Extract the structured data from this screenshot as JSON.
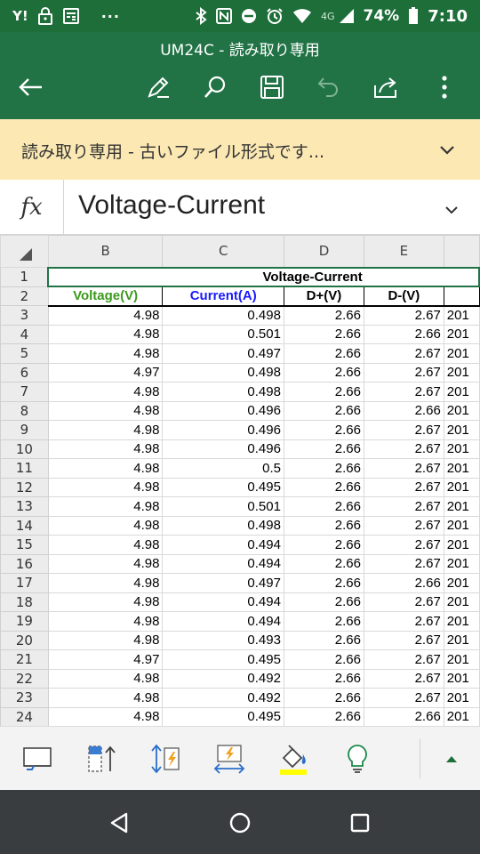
{
  "status_bar": {
    "carrier_icon": "Y!",
    "dots": "···",
    "network": "4G",
    "battery_pct": "74%",
    "time": "7:10"
  },
  "app_bar": {
    "title": "UM24C - 読み取り専用",
    "icons": [
      "back-arrow-icon",
      "edit-pen-icon",
      "search-icon",
      "save-disk-icon",
      "undo-icon",
      "share-icon",
      "more-vert-icon"
    ]
  },
  "banner": {
    "text": "読み取り専用 - 古いファイル形式です..."
  },
  "formula_bar": {
    "fx_label": "fx",
    "content": "Voltage-Current"
  },
  "sheet": {
    "column_headers": [
      "B",
      "C",
      "D",
      "E",
      ""
    ],
    "title_row": {
      "row": "1",
      "title": "Voltage-Current"
    },
    "header_row": {
      "row": "2",
      "cells": [
        "Voltage(V)",
        "Current(A)",
        "D+(V)",
        "D-(V)",
        ""
      ]
    },
    "rows": [
      {
        "row": "3",
        "v": "4.98",
        "c": "0.498",
        "dp": "2.66",
        "dm": "2.67",
        "f": "201"
      },
      {
        "row": "4",
        "v": "4.98",
        "c": "0.501",
        "dp": "2.66",
        "dm": "2.66",
        "f": "201"
      },
      {
        "row": "5",
        "v": "4.98",
        "c": "0.497",
        "dp": "2.66",
        "dm": "2.67",
        "f": "201"
      },
      {
        "row": "6",
        "v": "4.97",
        "c": "0.498",
        "dp": "2.66",
        "dm": "2.67",
        "f": "201"
      },
      {
        "row": "7",
        "v": "4.98",
        "c": "0.498",
        "dp": "2.66",
        "dm": "2.67",
        "f": "201"
      },
      {
        "row": "8",
        "v": "4.98",
        "c": "0.496",
        "dp": "2.66",
        "dm": "2.66",
        "f": "201"
      },
      {
        "row": "9",
        "v": "4.98",
        "c": "0.496",
        "dp": "2.66",
        "dm": "2.67",
        "f": "201"
      },
      {
        "row": "10",
        "v": "4.98",
        "c": "0.496",
        "dp": "2.66",
        "dm": "2.67",
        "f": "201"
      },
      {
        "row": "11",
        "v": "4.98",
        "c": "0.5",
        "dp": "2.66",
        "dm": "2.67",
        "f": "201"
      },
      {
        "row": "12",
        "v": "4.98",
        "c": "0.495",
        "dp": "2.66",
        "dm": "2.67",
        "f": "201"
      },
      {
        "row": "13",
        "v": "4.98",
        "c": "0.501",
        "dp": "2.66",
        "dm": "2.67",
        "f": "201"
      },
      {
        "row": "14",
        "v": "4.98",
        "c": "0.498",
        "dp": "2.66",
        "dm": "2.67",
        "f": "201"
      },
      {
        "row": "15",
        "v": "4.98",
        "c": "0.494",
        "dp": "2.66",
        "dm": "2.67",
        "f": "201"
      },
      {
        "row": "16",
        "v": "4.98",
        "c": "0.494",
        "dp": "2.66",
        "dm": "2.67",
        "f": "201"
      },
      {
        "row": "17",
        "v": "4.98",
        "c": "0.497",
        "dp": "2.66",
        "dm": "2.66",
        "f": "201"
      },
      {
        "row": "18",
        "v": "4.98",
        "c": "0.494",
        "dp": "2.66",
        "dm": "2.67",
        "f": "201"
      },
      {
        "row": "19",
        "v": "4.98",
        "c": "0.494",
        "dp": "2.66",
        "dm": "2.67",
        "f": "201"
      },
      {
        "row": "20",
        "v": "4.98",
        "c": "0.493",
        "dp": "2.66",
        "dm": "2.67",
        "f": "201"
      },
      {
        "row": "21",
        "v": "4.97",
        "c": "0.495",
        "dp": "2.66",
        "dm": "2.67",
        "f": "201"
      },
      {
        "row": "22",
        "v": "4.98",
        "c": "0.492",
        "dp": "2.66",
        "dm": "2.67",
        "f": "201"
      },
      {
        "row": "23",
        "v": "4.98",
        "c": "0.492",
        "dp": "2.66",
        "dm": "2.67",
        "f": "201"
      },
      {
        "row": "24",
        "v": "4.98",
        "c": "0.495",
        "dp": "2.66",
        "dm": "2.66",
        "f": "201"
      }
    ]
  },
  "bottom_toolbar": {
    "icons": [
      "show-keyboard-icon",
      "insert-column-icon",
      "row-height-icon",
      "column-autofit-icon",
      "fill-color-icon",
      "tell-me-bulb-icon",
      "expand-up-icon"
    ],
    "fill_color": "#ffff00"
  },
  "nav_bar": {
    "icons": [
      "nav-back-icon",
      "nav-home-icon",
      "nav-recents-icon"
    ]
  },
  "colors": {
    "status_bar": "#1e6e39",
    "app_bar": "#217346",
    "banner": "#fbe8b3",
    "voltage_header": "#3a9a1c",
    "current_header": "#1a1aff"
  }
}
